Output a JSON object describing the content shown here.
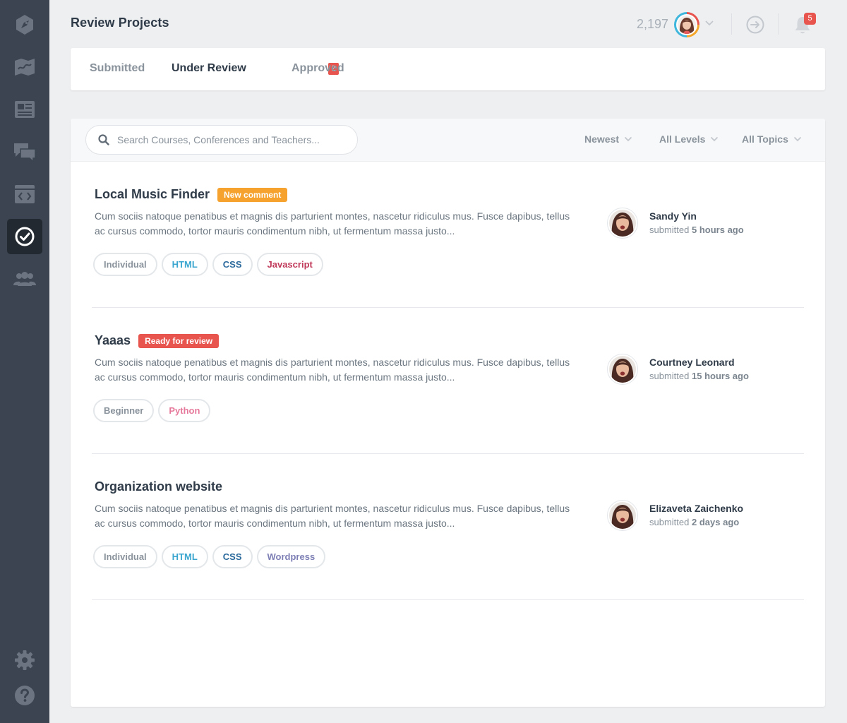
{
  "sidebar": {
    "items": [
      {
        "icon": "rocket-icon",
        "active": false
      },
      {
        "icon": "map-icon",
        "active": false
      },
      {
        "icon": "newspaper-icon",
        "active": false
      },
      {
        "icon": "chat-icon",
        "active": false
      },
      {
        "icon": "code-window-icon",
        "active": false
      },
      {
        "icon": "check-circle-icon",
        "active": true
      },
      {
        "icon": "users-icon",
        "active": false
      }
    ],
    "bottom_items": [
      {
        "icon": "gear-icon"
      },
      {
        "icon": "help-icon"
      }
    ]
  },
  "header": {
    "title": "Review Projects",
    "points": "2,197",
    "notifications_count": "5"
  },
  "tabs": [
    {
      "label": "Submitted",
      "active": false
    },
    {
      "label": "Under Review",
      "active": true,
      "badge": "2"
    },
    {
      "label": "Approved",
      "active": false
    }
  ],
  "filters": {
    "search_placeholder": "Search Courses, Conferences and Teachers...",
    "sort": "Newest",
    "level": "All Levels",
    "topic": "All Topics"
  },
  "projects": [
    {
      "title": "Local Music Finder",
      "badge": "New comment",
      "badge_color": "#f5a22e",
      "description": "Cum sociis natoque penatibus et magnis dis parturient montes, nascetur ridiculus mus. Fusce dapibus, tellus ac cursus commodo, tortor mauris condimentum nibh, ut fermentum massa justo...",
      "tags": [
        {
          "label": "Individual",
          "color": "#8a939c"
        },
        {
          "label": "HTML",
          "color": "#3aa6cf"
        },
        {
          "label": "CSS",
          "color": "#2b6a9c"
        },
        {
          "label": "Javascript",
          "color": "#c0395a"
        }
      ],
      "submitter": "Sandy Yin",
      "submitted_prefix": "submitted",
      "submitted_time": "5 hours ago"
    },
    {
      "title": "Yaaas",
      "badge": "Ready for review",
      "badge_color": "#e8544e",
      "description": "Cum sociis natoque penatibus et magnis dis parturient montes, nascetur ridiculus mus. Fusce dapibus, tellus ac cursus commodo, tortor mauris condimentum nibh, ut fermentum massa justo...",
      "tags": [
        {
          "label": "Beginner",
          "color": "#8a939c"
        },
        {
          "label": "Python",
          "color": "#e6799b"
        }
      ],
      "submitter": "Courtney Leonard",
      "submitted_prefix": "submitted",
      "submitted_time": "15 hours ago"
    },
    {
      "title": "Organization website",
      "badge": "",
      "badge_color": "",
      "description": "Cum sociis natoque penatibus et magnis dis parturient montes, nascetur ridiculus mus. Fusce dapibus, tellus ac cursus commodo, tortor mauris condimentum nibh, ut fermentum massa justo...",
      "tags": [
        {
          "label": "Individual",
          "color": "#8a939c"
        },
        {
          "label": "HTML",
          "color": "#3aa6cf"
        },
        {
          "label": "CSS",
          "color": "#2b6a9c"
        },
        {
          "label": "Wordpress",
          "color": "#7d7fb5"
        }
      ],
      "submitter": "Elizaveta Zaichenko",
      "submitted_prefix": "submitted",
      "submitted_time": "2 days ago"
    }
  ]
}
